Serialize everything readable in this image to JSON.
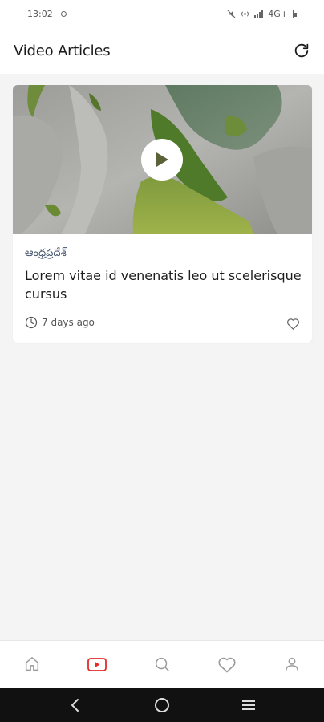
{
  "status_bar": {
    "time": "13:02",
    "network": "4G+",
    "network_prefix": "⁴⁶"
  },
  "header": {
    "title": "Video Articles",
    "refresh_icon": "refresh-icon"
  },
  "articles": [
    {
      "category": "ఆంధ్రప్రదేశ్",
      "title": "Lorem vitae id venenatis leo ut scelerisque cursus",
      "time_ago": "7 days ago",
      "liked": false
    }
  ],
  "bottom_nav": {
    "items": [
      "home-icon",
      "video-icon",
      "search-icon",
      "heart-icon",
      "profile-icon"
    ],
    "active_index": 1,
    "active_color": "#e52a2a",
    "inactive_color": "#9a9a9a"
  },
  "system_nav": [
    "back-icon",
    "home-circle-icon",
    "menu-icon"
  ]
}
